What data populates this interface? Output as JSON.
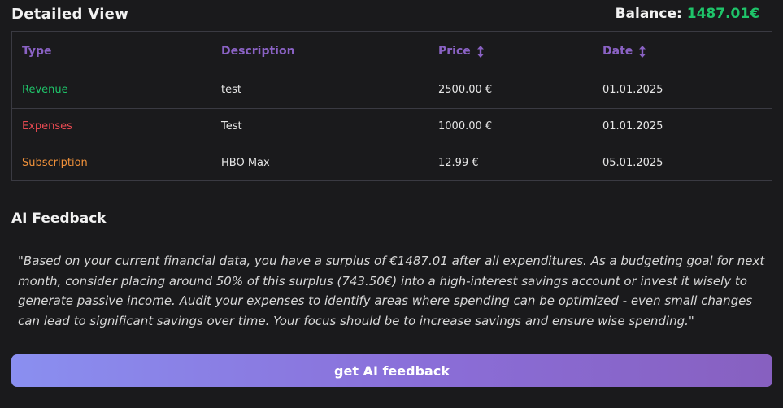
{
  "header": {
    "title": "Detailed View",
    "balance_label": "Balance:",
    "balance_value": "1487.01€"
  },
  "colors": {
    "revenue": "#1fc46a",
    "expenses": "#e84a52",
    "subscription": "#f0913a",
    "accent": "#8a62c4"
  },
  "table": {
    "headers": {
      "type": "Type",
      "description": "Description",
      "price": "Price",
      "date": "Date"
    },
    "rows": [
      {
        "type": "Revenue",
        "description": "test",
        "price": "2500.00 €",
        "date": "01.01.2025"
      },
      {
        "type": "Expenses",
        "description": "Test",
        "price": "1000.00 €",
        "date": "01.01.2025"
      },
      {
        "type": "Subscription",
        "description": "HBO Max",
        "price": "12.99 €",
        "date": "05.01.2025"
      }
    ]
  },
  "ai": {
    "title": "AI Feedback",
    "text": "\"Based on your current financial data, you have a surplus of €1487.01 after all expenditures. As a budgeting goal for next month, consider placing around 50% of this surplus (743.50€) into a high-interest savings account or invest it wisely to generate passive income. Audit your expenses to identify areas where spending can be optimized - even small changes can lead to significant savings over time. Your focus should be to increase savings and ensure wise spending.\"",
    "button_label": "get AI feedback"
  }
}
